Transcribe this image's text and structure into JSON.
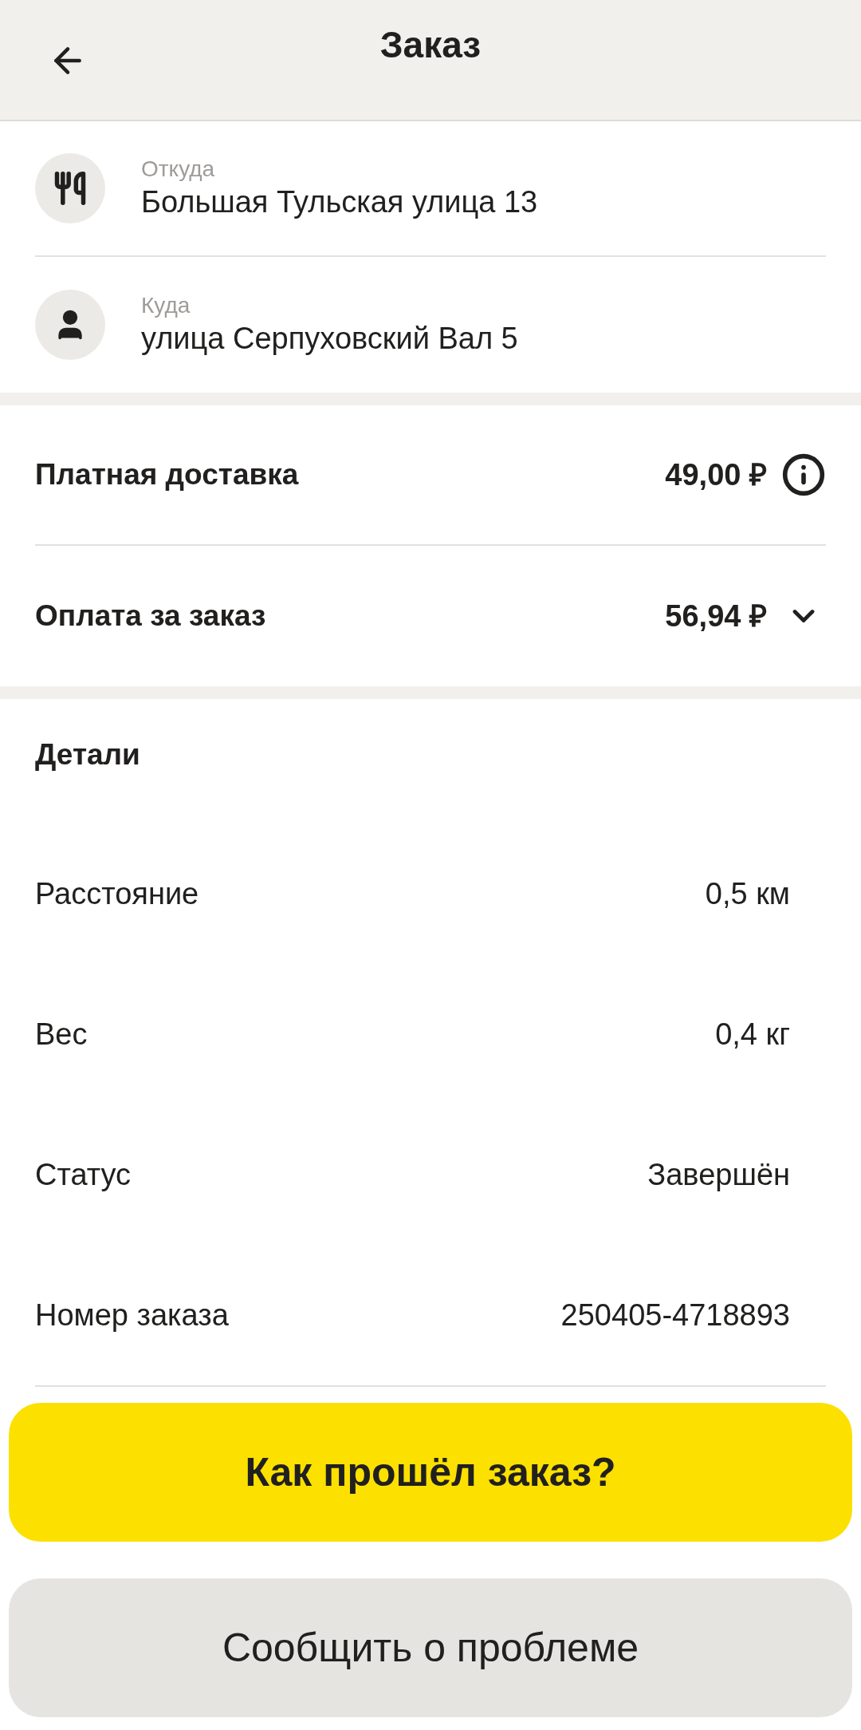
{
  "header": {
    "title": "Заказ"
  },
  "route": [
    {
      "kind": "restaurant",
      "label": "Откуда",
      "address": "Большая Тульская улица 13"
    },
    {
      "kind": "person",
      "label": "Куда",
      "address": "улица Серпуховский Вал 5"
    }
  ],
  "payments": [
    {
      "kind": "info",
      "label": "Платная доставка",
      "amount": "49,00 ₽"
    },
    {
      "kind": "expand",
      "label": "Оплата за заказ",
      "amount": "56,94 ₽",
      "expanded": false
    }
  ],
  "details": {
    "title": "Детали",
    "rows": [
      {
        "label": "Расстояние",
        "value": "0,5 км"
      },
      {
        "label": "Вес",
        "value": "0,4 кг"
      },
      {
        "label": "Статус",
        "value": "Завершён"
      },
      {
        "label": "Номер заказа",
        "value": "250405-4718893"
      }
    ]
  },
  "buttons": [
    {
      "kind": "primary",
      "label": "Как прошёл заказ?"
    },
    {
      "kind": "secondary",
      "label": "Сообщить о проблеме"
    }
  ]
}
